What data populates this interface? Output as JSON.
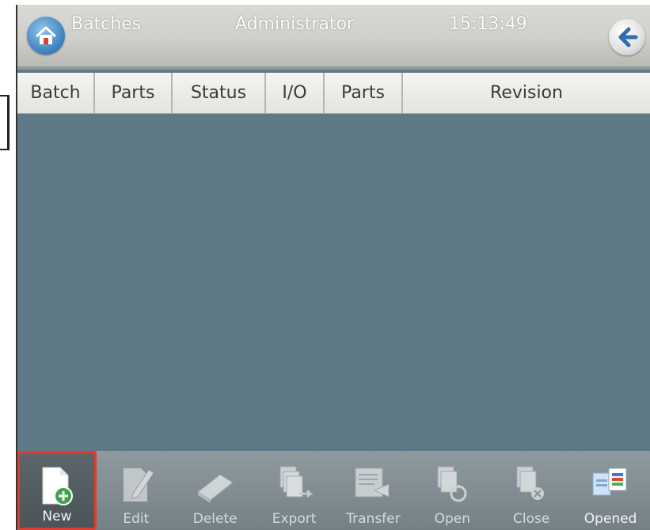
{
  "titlebar": {
    "title": "Batches",
    "user": "Administrator",
    "time": "15:13:49"
  },
  "table": {
    "columns": [
      "Batch",
      "Parts",
      "Status",
      "I/O",
      "Parts",
      "Revision"
    ],
    "rows": []
  },
  "toolbar": {
    "buttons": [
      {
        "label": "New",
        "icon": "new-document-icon",
        "selected": true
      },
      {
        "label": "Edit",
        "icon": "edit-icon"
      },
      {
        "label": "Delete",
        "icon": "delete-icon"
      },
      {
        "label": "Export",
        "icon": "export-icon"
      },
      {
        "label": "Transfer",
        "icon": "transfer-icon"
      },
      {
        "label": "Open",
        "icon": "open-icon"
      },
      {
        "label": "Close",
        "icon": "close-icon"
      },
      {
        "label": "Opened",
        "icon": "opened-icon"
      }
    ]
  },
  "colors": {
    "background": "#5f7a86",
    "titlebar": "#cfcfcb",
    "toolbar": "#7f8b90",
    "selection_border": "#e23b2f",
    "new_badge": "#3aa54a"
  }
}
